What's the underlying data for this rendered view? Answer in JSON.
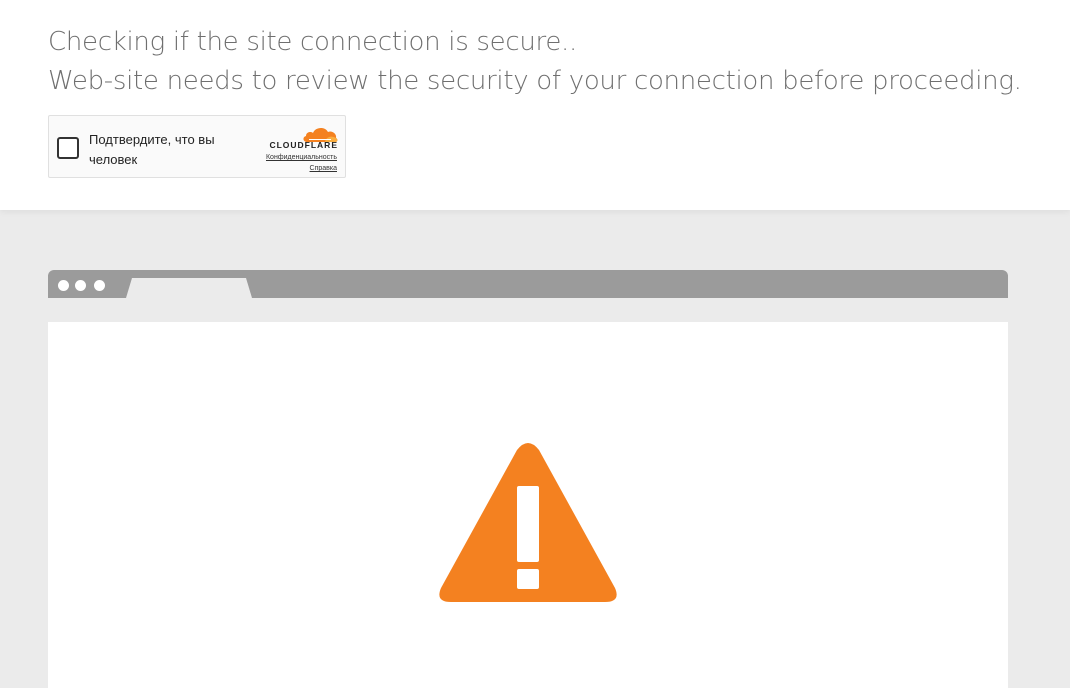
{
  "header": {
    "line1": "Checking if the site connection is secure..",
    "line2": "Web-site needs to review the security of your connection before proceeding."
  },
  "captcha": {
    "label": "Подтвердите, что вы человек",
    "brand": "CLOUDFLARE",
    "privacy_link": "Конфиденциальность",
    "help_link": "Справка",
    "checked": false
  },
  "colors": {
    "accent": "#f48120",
    "brand_light": "#faad3f",
    "browser_bar": "#9b9b9b",
    "page_bg": "#ebebeb",
    "heading_text": "#6f6f6f"
  },
  "icons": {
    "logo": "cloudflare-cloud-icon",
    "warning": "warning-triangle-icon"
  }
}
